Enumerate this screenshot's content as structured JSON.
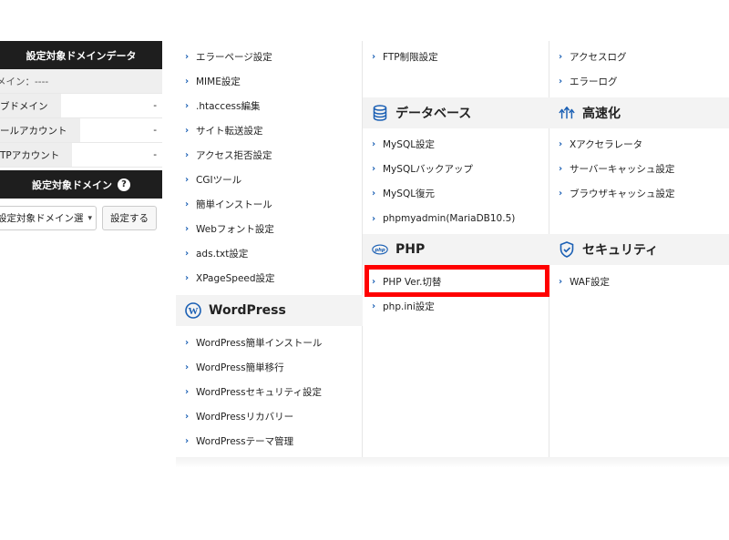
{
  "left_panel": {
    "header": "設定対象ドメインデータ",
    "rows": [
      {
        "label": "メイン：----",
        "value": ""
      },
      {
        "label": "ブドメイン",
        "value": "-"
      },
      {
        "label": "ールアカウント",
        "value": "-"
      },
      {
        "label": "TPアカウント",
        "value": "-"
      }
    ],
    "domain_header": "設定対象ドメイン",
    "help_icon": "?",
    "select_value": "設定対象ドメイン選",
    "set_button": "設定する"
  },
  "col1": {
    "items": [
      "エラーページ設定",
      "MIME設定",
      ".htaccess編集",
      "サイト転送設定",
      "アクセス拒否設定",
      "CGIツール",
      "簡単インストール",
      "Webフォント設定",
      "ads.txt設定",
      "XPageSpeed設定"
    ],
    "wp_section": {
      "title": "WordPress",
      "icon": "wordpress-icon"
    },
    "wp_items": [
      "WordPress簡単インストール",
      "WordPress簡単移行",
      "WordPressセキュリティ設定",
      "WordPressリカバリー",
      "WordPressテーマ管理"
    ]
  },
  "col2": {
    "items": [
      "FTP制限設定"
    ],
    "db_section": {
      "title": "データベース",
      "icon": "database-icon"
    },
    "db_items": [
      "MySQL設定",
      "MySQLバックアップ",
      "MySQL復元",
      "phpmyadmin(MariaDB10.5)"
    ],
    "php_section": {
      "title": "PHP",
      "icon": "php-icon"
    },
    "php_items": [
      "PHP Ver.切替",
      "php.ini設定"
    ]
  },
  "col3": {
    "items": [
      "アクセスログ",
      "エラーログ"
    ],
    "speed_section": {
      "title": "高速化",
      "icon": "speed-icon"
    },
    "speed_items": [
      "Xアクセラレータ",
      "サーバーキャッシュ設定",
      "ブラウザキャッシュ設定"
    ],
    "security_section": {
      "title": "セキュリティ",
      "icon": "shield-icon"
    },
    "security_items": [
      "WAF設定"
    ]
  },
  "colors": {
    "accent": "#1a5fb4",
    "highlight": "#ff0000",
    "header_bg": "#1e1e1e"
  }
}
